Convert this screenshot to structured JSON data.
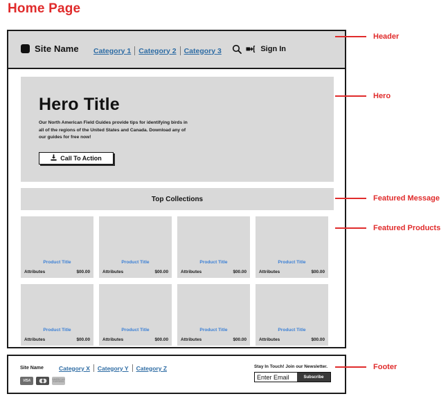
{
  "page_title": "Home Page",
  "accent_color": "#e02b2b",
  "link_color": "#2e6ca4",
  "product_link_color": "#3a7fd5",
  "panel_color": "#d9d9d9",
  "header": {
    "brand_name": "Site Name",
    "logo_icon": "square-logo-icon",
    "nav": [
      {
        "label": "Category 1"
      },
      {
        "label": "Category 2"
      },
      {
        "label": "Category 3"
      }
    ],
    "search_icon": "search-icon",
    "signin_icon": "sign-in-arrow-icon",
    "signin_label": "Sign In"
  },
  "hero": {
    "title": "Hero Title",
    "body": "Our North American Field Guides provide tips for identifying birds in all of the regions of the United States and Canada. Download any of our guides for free now!",
    "cta_icon": "download-icon",
    "cta_label": "Call To Action"
  },
  "featured_message": {
    "text": "Top Collections"
  },
  "products": [
    {
      "title": "Product Title",
      "attributes": "Attributes",
      "price": "$00.00"
    },
    {
      "title": "Product Title",
      "attributes": "Attributes",
      "price": "$00.00"
    },
    {
      "title": "Product Title",
      "attributes": "Attributes",
      "price": "$00.00"
    },
    {
      "title": "Product Title",
      "attributes": "Attributes",
      "price": "$00.00"
    },
    {
      "title": "Product Title",
      "attributes": "Attributes",
      "price": "$00.00"
    },
    {
      "title": "Product Title",
      "attributes": "Attributes",
      "price": "$00.00"
    },
    {
      "title": "Product Title",
      "attributes": "Attributes",
      "price": "$00.00"
    },
    {
      "title": "Product Title",
      "attributes": "Attributes",
      "price": "$00.00"
    }
  ],
  "footer": {
    "brand_name": "Site Name",
    "nav": [
      {
        "label": "Category X"
      },
      {
        "label": "Category Y"
      },
      {
        "label": "Category Z"
      }
    ],
    "payment_methods": [
      {
        "name": "visa-card-icon",
        "label": "VISA"
      },
      {
        "name": "mastercard-icon",
        "label": ""
      },
      {
        "name": "amex-card-icon",
        "label": "AMERICAN EXPRESS"
      }
    ],
    "newsletter_label": "Stay In Touch! Join our Newsletter.",
    "email_value": "Enter Email",
    "email_placeholder": "Enter Email",
    "subscribe_label": "Subscribe"
  },
  "annotations": [
    {
      "label": "Header"
    },
    {
      "label": "Hero"
    },
    {
      "label": "Featured Message"
    },
    {
      "label": "Featured Products"
    },
    {
      "label": "Footer"
    }
  ]
}
